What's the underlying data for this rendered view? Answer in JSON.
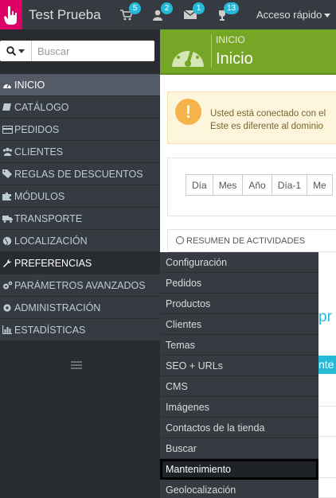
{
  "header": {
    "shop_name": "Test Prueba",
    "badges": {
      "orders": "5",
      "customers": "2",
      "messages": "1",
      "trophies": "13"
    },
    "quick_access": "Acceso rápido"
  },
  "search": {
    "placeholder": "Buscar"
  },
  "sidebar": {
    "items": [
      {
        "label": "Inicio",
        "icon": "dashboard-icon"
      },
      {
        "label": "Catálogo",
        "icon": "book-icon"
      },
      {
        "label": "Pedidos",
        "icon": "credit-card-icon"
      },
      {
        "label": "Clientes",
        "icon": "users-icon"
      },
      {
        "label": "Reglas de descuentos",
        "icon": "tag-icon"
      },
      {
        "label": "Módulos",
        "icon": "puzzle-icon"
      },
      {
        "label": "Transporte",
        "icon": "truck-icon"
      },
      {
        "label": "Localización",
        "icon": "globe-icon"
      },
      {
        "label": "Preferencias",
        "icon": "wrench-icon"
      },
      {
        "label": "Parámetros avanzados",
        "icon": "cogs-icon"
      },
      {
        "label": "Administración",
        "icon": "cog-icon"
      },
      {
        "label": "Estadísticas",
        "icon": "bar-chart-icon"
      }
    ]
  },
  "page": {
    "breadcrumb": "INICIO",
    "title": "Inicio"
  },
  "alert": {
    "line1": "Usted está conectado con el",
    "line2": "Este es diferente al dominio"
  },
  "date_buttons": [
    "Día",
    "Mes",
    "Año",
    "Día-1",
    "Me"
  ],
  "activity": {
    "title": "Resumen de actividades",
    "fragment_text": "pr",
    "fragment_button": "nte"
  },
  "submenu": {
    "items": [
      "Configuración",
      "Pedidos",
      "Productos",
      "Clientes",
      "Temas",
      "SEO + URLs",
      "CMS",
      "Imágenes",
      "Contactos de la tienda",
      "Buscar",
      "Mantenimiento",
      "Geolocalización"
    ],
    "selected": "Mantenimiento"
  },
  "colors": {
    "topbar": "#363a41",
    "logo": "#df0067",
    "badge": "#25b9d7",
    "header_green": "#75a626",
    "alert_bg": "#fdf5dc",
    "alert_icon": "#f4b34b"
  }
}
